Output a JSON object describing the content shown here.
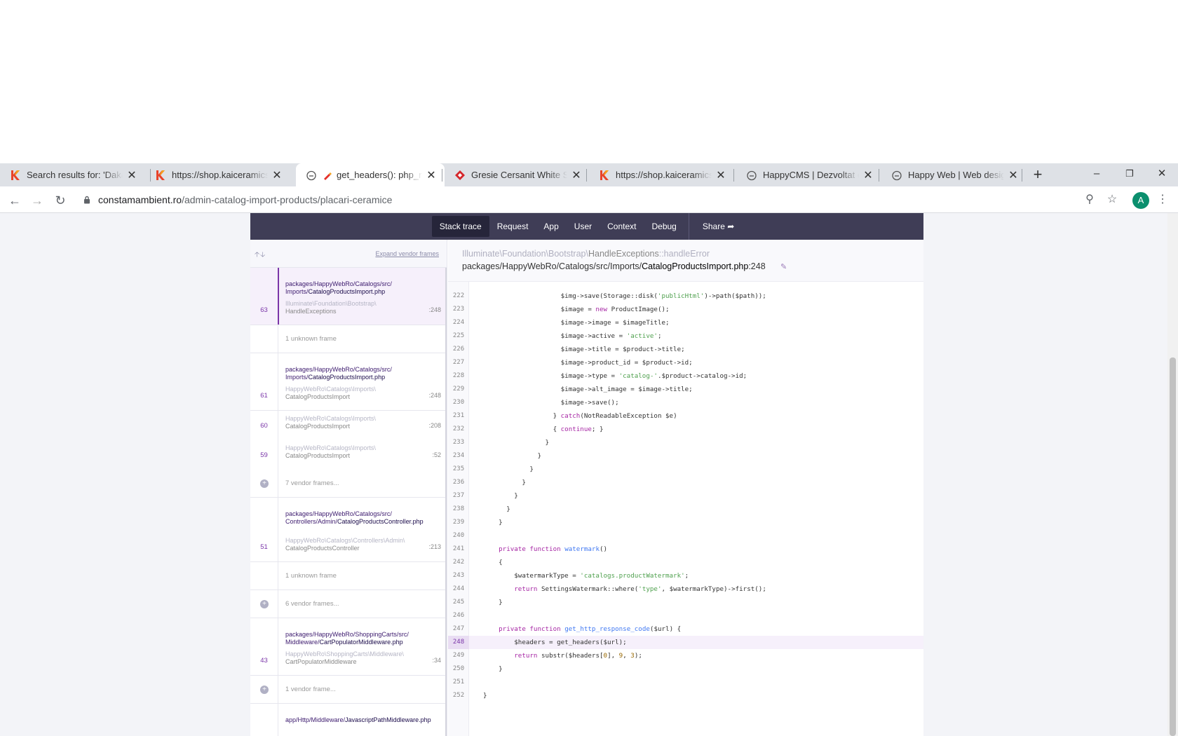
{
  "browser": {
    "tabs": [
      {
        "title": "Search results for: 'Dakar' |",
        "favicon": "kai-favicon",
        "active": false
      },
      {
        "title": "https://shop.kaiceramics.ro",
        "favicon": "kai-favicon",
        "active": false
      },
      {
        "title": "get_headers(): php_net",
        "favicon": "ignition-favicon",
        "active": true
      },
      {
        "title": "Gresie Cersanit White Satin",
        "favicon": "diamond-favicon",
        "active": false
      },
      {
        "title": "https://shop.kaiceramics.ro",
        "favicon": "kai-favicon",
        "active": false
      },
      {
        "title": "HappyCMS | Dezvoltat de",
        "favicon": "globe-favicon",
        "active": false
      },
      {
        "title": "Happy Web | Web design",
        "favicon": "globe-favicon",
        "active": false
      }
    ],
    "new_tab": "+",
    "window_controls": {
      "minimize": "–",
      "restore": "❐",
      "close": "✕"
    },
    "url_host": "constamambient.ro",
    "url_path": "/admin-catalog-import-products/placari-ceramice",
    "avatar_letter": "A"
  },
  "ignition": {
    "nav": [
      "Stack trace",
      "Request",
      "App",
      "User",
      "Context",
      "Debug"
    ],
    "share_label": "Share",
    "expand_vendor": "Expand vendor frames",
    "frames": [
      {
        "type": "app",
        "num": "63",
        "file_dir": "packages/HappyWebRo/Catalogs/src/ Imports/",
        "file_name": "CatalogProductsImport.php",
        "cls_ns": "Illuminate\\Foundation\\Bootstrap\\",
        "cls_name": "HandleExceptions",
        "line": ":248",
        "selected": true
      },
      {
        "type": "muted",
        "text": "1 unknown frame"
      },
      {
        "type": "app",
        "num": "61",
        "file_dir": "packages/HappyWebRo/Catalogs/src/ Imports/",
        "file_name": "CatalogProductsImport.php",
        "cls_ns": "HappyWebRo\\Catalogs\\Imports\\",
        "cls_name": "CatalogProductsImport",
        "line": ":248"
      },
      {
        "type": "sub",
        "num": "60",
        "cls_ns": "HappyWebRo\\Catalogs\\Imports\\",
        "cls_name": "CatalogProductsImport",
        "line": ":208"
      },
      {
        "type": "sub",
        "num": "59",
        "cls_ns": "HappyWebRo\\Catalogs\\Imports\\",
        "cls_name": "CatalogProductsImport",
        "line": ":52"
      },
      {
        "type": "vendor",
        "text": "7 vendor frames..."
      },
      {
        "type": "app",
        "num": "51",
        "file_dir": "packages/HappyWebRo/Catalogs/src/ Controllers/Admin/",
        "file_name": "CatalogProductsController.php",
        "cls_ns": "HappyWebRo\\Catalogs\\Controllers\\Admin\\",
        "cls_name": "CatalogProductsController",
        "line": ":213"
      },
      {
        "type": "muted",
        "text": "1 unknown frame"
      },
      {
        "type": "vendor",
        "text": "6 vendor frames..."
      },
      {
        "type": "app",
        "num": "43",
        "file_dir": "packages/HappyWebRo/ShoppingCarts/src/ Middleware/",
        "file_name": "CartPopulatorMiddleware.php",
        "cls_ns": "HappyWebRo\\ShoppingCarts\\Middleware\\",
        "cls_name": "CartPopulatorMiddleware",
        "line": ":34"
      },
      {
        "type": "vendor",
        "text": "1 vendor frame..."
      },
      {
        "type": "app",
        "num": "",
        "file_dir": "app/Http/Middleware/",
        "file_name": "JavascriptPathMiddleware.php",
        "cls_ns": "",
        "cls_name": "",
        "line": ""
      }
    ],
    "exception_ns": "Illuminate\\Foundation\\Bootstrap\\",
    "exception_cls": "HandleExceptions",
    "exception_method": "::handleError",
    "location_dir": "packages/HappyWebRo/Catalogs/src/Imports/",
    "location_file": "CatalogProductsImport.php",
    "location_line": ":248",
    "highlight_line": "248",
    "code": [
      {
        "n": "222",
        "html": "                    $img-&gt;save(Storage::disk(<span class=\"str\">'publicHtml'</span>)-&gt;path($path));"
      },
      {
        "n": "223",
        "html": "                    $image = <span class=\"kw\">new</span> ProductImage();"
      },
      {
        "n": "224",
        "html": "                    $image-&gt;image = $imageTitle;"
      },
      {
        "n": "225",
        "html": "                    $image-&gt;active = <span class=\"str\">'active'</span>;"
      },
      {
        "n": "226",
        "html": "                    $image-&gt;title = $product-&gt;title;"
      },
      {
        "n": "227",
        "html": "                    $image-&gt;product_id = $product-&gt;id;"
      },
      {
        "n": "228",
        "html": "                    $image-&gt;type = <span class=\"str\">'catalog-'</span>.$product-&gt;catalog-&gt;id;"
      },
      {
        "n": "229",
        "html": "                    $image-&gt;alt_image = $image-&gt;title;"
      },
      {
        "n": "230",
        "html": "                    $image-&gt;save();"
      },
      {
        "n": "231",
        "html": "                  } <span class=\"kw\">catch</span>(NotReadableException $e)"
      },
      {
        "n": "232",
        "html": "                  { <span class=\"kw\">continue</span>; }"
      },
      {
        "n": "233",
        "html": "                }"
      },
      {
        "n": "234",
        "html": "              }"
      },
      {
        "n": "235",
        "html": "            }"
      },
      {
        "n": "236",
        "html": "          }"
      },
      {
        "n": "237",
        "html": "        }"
      },
      {
        "n": "238",
        "html": "      }"
      },
      {
        "n": "239",
        "html": "    }"
      },
      {
        "n": "240",
        "html": ""
      },
      {
        "n": "241",
        "html": "    <span class=\"kw\">private function</span> <span class=\"fn\">watermark</span>()"
      },
      {
        "n": "242",
        "html": "    {"
      },
      {
        "n": "243",
        "html": "        $watermarkType = <span class=\"str\">'catalogs.productWatermark'</span>;"
      },
      {
        "n": "244",
        "html": "        <span class=\"kw\">return</span> SettingsWatermark::where(<span class=\"str\">'type'</span>, $watermarkType)-&gt;first();"
      },
      {
        "n": "245",
        "html": "    }"
      },
      {
        "n": "246",
        "html": ""
      },
      {
        "n": "247",
        "html": "    <span class=\"kw\">private function</span> <span class=\"fn\">get_http_response_code</span>($url) {"
      },
      {
        "n": "248",
        "html": "        $headers = get_headers($url);"
      },
      {
        "n": "249",
        "html": "        <span class=\"kw\">return</span> substr($headers[<span class=\"num\">0</span>], <span class=\"num\">9</span>, <span class=\"num\">3</span>);"
      },
      {
        "n": "250",
        "html": "    }"
      },
      {
        "n": "251",
        "html": ""
      },
      {
        "n": "252",
        "html": "}"
      }
    ]
  },
  "colors": {
    "nav_bg": "#3f3d56",
    "accent": "#7a35a8",
    "avatar": "#0b8f6e"
  }
}
